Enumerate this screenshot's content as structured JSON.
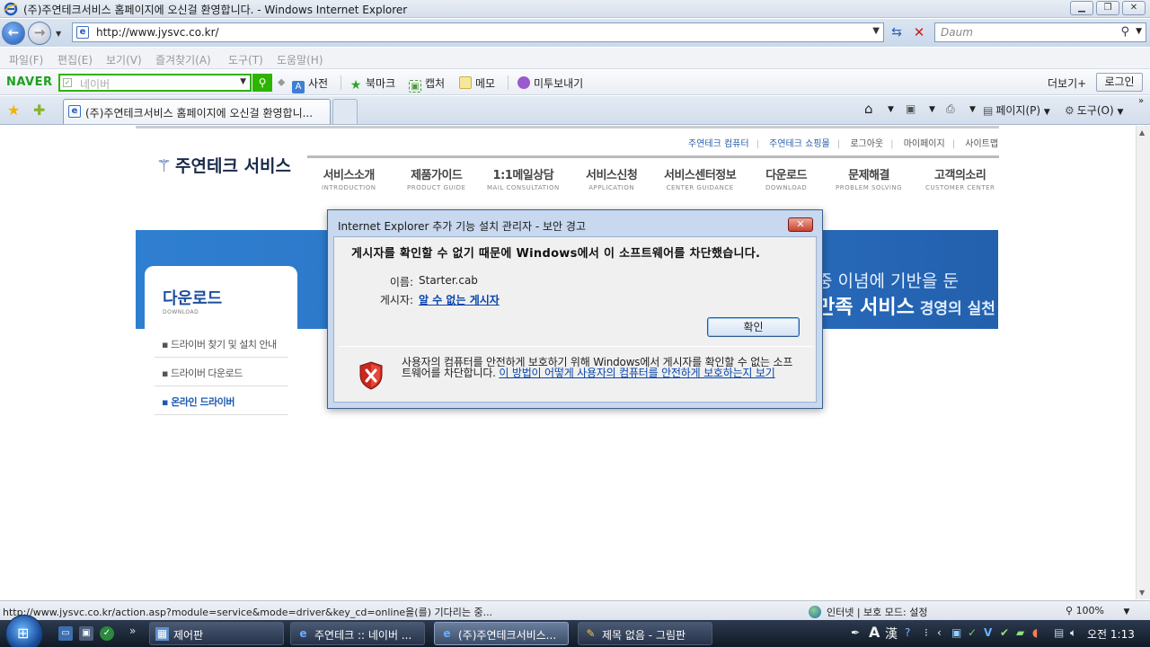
{
  "window": {
    "title": "(주)주연테크서비스 홈페이지에 오신걸 환영합니다. - Windows Internet Explorer",
    "minimize_glyph": "▁",
    "maximize_glyph": "❐",
    "close_glyph": "✕"
  },
  "address_bar": {
    "url": "http://www.jysvc.co.kr/",
    "search_placeholder": "Daum"
  },
  "menu": {
    "items": [
      "파일(F)",
      "편집(E)",
      "보기(V)",
      "즐겨찾기(A)",
      "도구(T)",
      "도움말(H)"
    ]
  },
  "naver_toolbar": {
    "logo": "NAVER",
    "search_placeholder": "네이버",
    "dictionary": "사전",
    "bookmark": "북마크",
    "capture": "캡처",
    "memo": "메모",
    "send": "미투보내기",
    "more": "더보기+",
    "login": "로그인"
  },
  "tabs": {
    "active_tab_label": "(주)주연테크서비스 홈페이지에 오신걸 환영합니...",
    "page_menu": "페이지(P)",
    "tools_menu": "도구(O)"
  },
  "site": {
    "util_links": [
      "주연테크 컴퓨터",
      "주연테크 쇼핑몰",
      "로그아웃",
      "마이페이지",
      "사이트맵"
    ],
    "logo": "주연테크 서비스",
    "gnb": [
      {
        "ko": "서비스소개",
        "en": "INTRODUCTION"
      },
      {
        "ko": "제품가이드",
        "en": "PRODUCT GUIDE"
      },
      {
        "ko": "1:1메일상담",
        "en": "MAIL CONSULTATION"
      },
      {
        "ko": "서비스신청",
        "en": "APPLICATION"
      },
      {
        "ko": "서비스센터정보",
        "en": "CENTER GUIDANCE"
      },
      {
        "ko": "다운로드",
        "en": "DOWNLOAD"
      },
      {
        "ko": "문제해결",
        "en": "PROBLEM SOLVING"
      },
      {
        "ko": "고객의소리",
        "en": "CUSTOMER CENTER"
      }
    ],
    "banner_line1": "중 이념에 기반을 둔",
    "banner_line2_bold": "만족 서비스",
    "banner_line2_rest": " 경영의 실천",
    "side_title": "다운로드",
    "side_title_en": "DOWNLOAD",
    "side_menu": [
      "드라이버 찾기 및 설치 안내",
      "드라이버 다운로드",
      "온라인 드라이버"
    ]
  },
  "dialog": {
    "title": "Internet Explorer 추가 기능 설치 관리자 - 보안 경고",
    "close_glyph": "✕",
    "headline": "게시자를 확인할 수 없기 때문에 Windows에서 이 소프트웨어를 차단했습니다.",
    "name_label": "이름:",
    "name_value": "Starter.cab",
    "publisher_label": "게시자:",
    "publisher_value": "알 수 없는 게시자",
    "ok_button": "확인",
    "warning_text": "사용자의 컴퓨터를 안전하게 보호하기 위해 Windows에서 게시자를 확인할 수 없는 소프트웨어를 차단합니다.",
    "warning_link": "이 방법이 어떻게 사용자의 컴퓨터를 안전하게 보호하는지 보기"
  },
  "status_bar": {
    "text": "http://www.jysvc.co.kr/action.asp?module=service&mode=driver&key_cd=online을(를) 기다리는 중...",
    "zone": "인터넷 | 보호 모드: 설정",
    "zoom": "100%"
  },
  "taskbar": {
    "tasks": [
      {
        "label": "제어판",
        "icon": "control-panel-icon"
      },
      {
        "label": "주연테크 :: 네이버 ...",
        "icon": "ie-icon"
      },
      {
        "label": "(주)주연테크서비스...",
        "icon": "ie-icon"
      },
      {
        "label": "제목 없음 - 그림판",
        "icon": "paint-icon"
      }
    ],
    "clock": "오전 1:13"
  },
  "colors": {
    "ie_blue": "#1e5bb8",
    "naver_green": "#2db400",
    "banner_blue": "#2a70c2",
    "link_blue": "#0645ad"
  }
}
